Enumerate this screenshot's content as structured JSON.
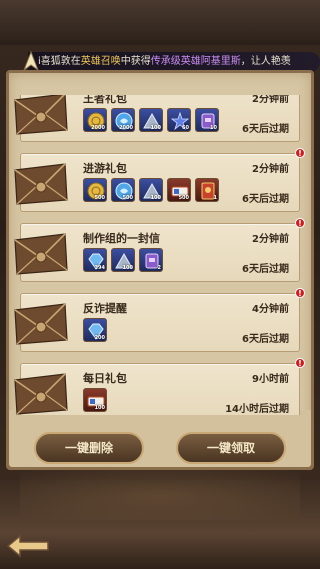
{
  "marquee": {
    "prefix": "i喜狐敦在",
    "place": "英雄召唤",
    "mid": "中获得",
    "rarity": "传承级英雄",
    "hero": "阿基里斯",
    "suffix": "，让人艳羡"
  },
  "mails": [
    {
      "title": "王者礼包",
      "time": "2分钟前",
      "expire": "6天后过期",
      "unread": false,
      "items": [
        {
          "icon": "gold-coin-icon",
          "qty": "2000",
          "rarity": "rare"
        },
        {
          "icon": "spirit-orb-icon",
          "qty": "2000",
          "rarity": "rare"
        },
        {
          "icon": "pyramid-stone-icon",
          "qty": "100",
          "rarity": "rare"
        },
        {
          "icon": "star-crystal-icon",
          "qty": "60",
          "rarity": "rare"
        },
        {
          "icon": "purple-scroll-icon",
          "qty": "10",
          "rarity": "rare"
        }
      ]
    },
    {
      "title": "进游礼包",
      "time": "2分钟前",
      "expire": "6天后过期",
      "unread": true,
      "items": [
        {
          "icon": "gold-coin-icon",
          "qty": "500",
          "rarity": "rare"
        },
        {
          "icon": "spirit-orb-icon",
          "qty": "500",
          "rarity": "rare"
        },
        {
          "icon": "pyramid-stone-icon",
          "qty": "100",
          "rarity": "rare"
        },
        {
          "icon": "summon-ticket-icon",
          "qty": "500",
          "rarity": "epic"
        },
        {
          "icon": "hero-card-icon",
          "qty": "1",
          "rarity": "epic"
        }
      ]
    },
    {
      "title": "制作组的一封信",
      "time": "2分钟前",
      "expire": "6天后过期",
      "unread": true,
      "items": [
        {
          "icon": "diamond-icon",
          "qty": "394",
          "rarity": "rare"
        },
        {
          "icon": "pyramid-stone-icon",
          "qty": "100",
          "rarity": "rare"
        },
        {
          "icon": "purple-scroll-icon",
          "qty": "2",
          "rarity": "rare"
        }
      ]
    },
    {
      "title": "反诈提醒",
      "time": "4分钟前",
      "expire": "6天后过期",
      "unread": true,
      "items": [
        {
          "icon": "diamond-icon",
          "qty": "200",
          "rarity": "rare"
        }
      ]
    },
    {
      "title": "每日礼包",
      "time": "9小时前",
      "expire": "14小时后过期",
      "unread": true,
      "items": [
        {
          "icon": "summon-ticket-icon",
          "qty": "100",
          "rarity": "epic"
        }
      ]
    }
  ],
  "buttons": {
    "delete_all": "一键删除",
    "claim_all": "一键领取"
  },
  "colors": {
    "panel": "#d7c6a3",
    "card": "#efe4cc",
    "badge": "#d01e1e",
    "button": "#5e4530"
  }
}
